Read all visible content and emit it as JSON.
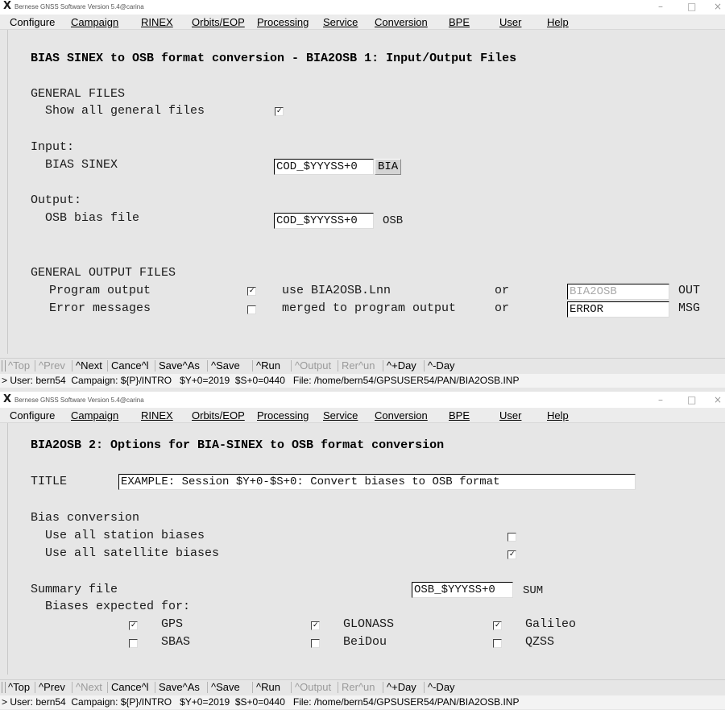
{
  "app_title": "Bernese GNSS Software Version 5.4@carina",
  "window_controls": {
    "minimize": "–",
    "maximize": "□",
    "close": "×"
  },
  "menu": [
    "Configure",
    "Campaign",
    "RINEX",
    "Orbits/EOP",
    "Processing",
    "Service",
    "Conversion",
    "BPE",
    "User",
    "Help"
  ],
  "win1": {
    "panel_title": "BIAS SINEX to OSB format conversion - BIA2OSB 1: Input/Output Files",
    "general_files_header": "GENERAL FILES",
    "show_all_label": "Show all general files",
    "show_all_checked": true,
    "input_header": "Input:",
    "bias_sinex_label": "BIAS SINEX",
    "bias_sinex_value": "COD_$YYYSS+0",
    "bias_sinex_ext": "BIA",
    "output_header": "Output:",
    "osb_label": "OSB bias file",
    "osb_value": "COD_$YYYSS+0",
    "osb_ext": "OSB",
    "gen_output_header": "GENERAL OUTPUT FILES",
    "prog_output_label": "Program output",
    "prog_output_checked": true,
    "prog_output_text": "use BIA2OSB.Lnn",
    "prog_or": "or",
    "prog_output_file": "BIA2OSB",
    "prog_output_ext": "OUT",
    "err_label": "Error messages",
    "err_checked": false,
    "err_text": "merged to program output",
    "err_or": "or",
    "err_file": "ERROR",
    "err_ext": "MSG",
    "status": "> User: bern54  Campaign: ${P}/INTRO   $Y+0=2019  $S+0=0440   File: /home/bern54/GPSUSER54/PAN/BIA2OSB.INP"
  },
  "win2": {
    "panel_title": "BIA2OSB 2: Options for BIA-SINEX to OSB format conversion",
    "title_label": "TITLE",
    "title_value": "EXAMPLE: Session $Y+0-$S+0: Convert biases to OSB format",
    "bias_conv_header": "Bias conversion",
    "use_station_label": "Use all station biases",
    "use_station_checked": false,
    "use_sat_label": "Use all satellite biases",
    "use_sat_checked": true,
    "summary_label": "Summary file",
    "summary_value": "OSB_$YYYSS+0",
    "summary_ext": "SUM",
    "biases_expected_label": "Biases expected for:",
    "systems": [
      {
        "name": "GPS",
        "checked": true
      },
      {
        "name": "GLONASS",
        "checked": true
      },
      {
        "name": "Galileo",
        "checked": true
      },
      {
        "name": "SBAS",
        "checked": false
      },
      {
        "name": "BeiDou",
        "checked": false
      },
      {
        "name": "QZSS",
        "checked": false
      }
    ],
    "status": "> User: bern54  Campaign: ${P}/INTRO   $Y+0=2019  $S+0=0440   File: /home/bern54/GPSUSER54/PAN/BIA2OSB.INP"
  },
  "toolbar1": [
    {
      "label": "^Top",
      "enabled": false
    },
    {
      "label": "^Prev",
      "enabled": false
    },
    {
      "label": "^Next",
      "enabled": true
    },
    {
      "label": "Cance^l",
      "enabled": true
    },
    {
      "label": "Save^As",
      "enabled": true
    },
    {
      "label": "^Save",
      "enabled": true
    },
    {
      "label": "^Run",
      "enabled": true
    },
    {
      "label": "^Output",
      "enabled": false
    },
    {
      "label": "Rer^un",
      "enabled": false
    },
    {
      "label": "^+Day",
      "enabled": true
    },
    {
      "label": "^-Day",
      "enabled": true
    }
  ],
  "toolbar2": [
    {
      "label": "^Top",
      "enabled": true
    },
    {
      "label": "^Prev",
      "enabled": true
    },
    {
      "label": "^Next",
      "enabled": false
    },
    {
      "label": "Cance^l",
      "enabled": true
    },
    {
      "label": "Save^As",
      "enabled": true
    },
    {
      "label": "^Save",
      "enabled": true
    },
    {
      "label": "^Run",
      "enabled": true
    },
    {
      "label": "^Output",
      "enabled": false
    },
    {
      "label": "Rer^un",
      "enabled": false
    },
    {
      "label": "^+Day",
      "enabled": true
    },
    {
      "label": "^-Day",
      "enabled": true
    }
  ]
}
